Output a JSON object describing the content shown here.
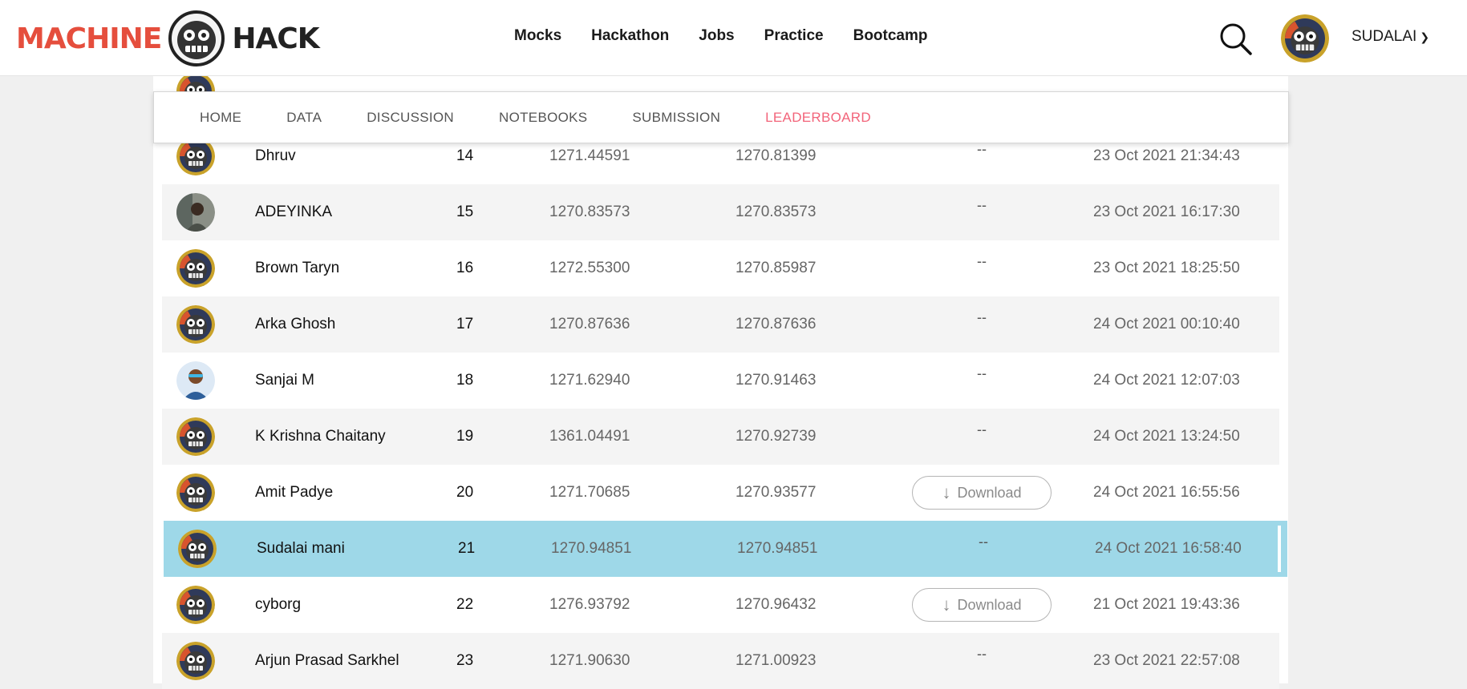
{
  "brand": {
    "word1": "MACHINE",
    "word2": "HACK"
  },
  "nav": {
    "items": [
      "Mocks",
      "Hackathon",
      "Jobs",
      "Practice",
      "Bootcamp"
    ]
  },
  "user": {
    "name": "SUDALAI"
  },
  "tabs": {
    "items": [
      "HOME",
      "DATA",
      "DISCUSSION",
      "NOTEBOOKS",
      "SUBMISSION",
      "LEADERBOARD"
    ],
    "active": "LEADERBOARD"
  },
  "leaderboard": {
    "rows": [
      {
        "name": "Dhruv",
        "rank": "14",
        "score_public": "1271.44591",
        "score_private": "1270.81399",
        "submission": "--",
        "date": "23 Oct 2021 21:34:43",
        "avatar_icon": "robot-avatar-icon"
      },
      {
        "name": "ADEYINKA",
        "rank": "15",
        "score_public": "1270.83573",
        "score_private": "1270.83573",
        "submission": "--",
        "date": "23 Oct 2021 16:17:30",
        "avatar_icon": "user-photo-icon"
      },
      {
        "name": "Brown Taryn",
        "rank": "16",
        "score_public": "1272.55300",
        "score_private": "1270.85987",
        "submission": "--",
        "date": "23 Oct 2021 18:25:50",
        "avatar_icon": "robot-avatar-icon"
      },
      {
        "name": "Arka Ghosh",
        "rank": "17",
        "score_public": "1270.87636",
        "score_private": "1270.87636",
        "submission": "--",
        "date": "24 Oct 2021 00:10:40",
        "avatar_icon": "robot-avatar-icon"
      },
      {
        "name": "Sanjai M",
        "rank": "18",
        "score_public": "1271.62940",
        "score_private": "1270.91463",
        "submission": "--",
        "date": "24 Oct 2021 12:07:03",
        "avatar_icon": "user-photo-icon"
      },
      {
        "name": "K Krishna Chaitany",
        "rank": "19",
        "score_public": "1361.04491",
        "score_private": "1270.92739",
        "submission": "--",
        "date": "24 Oct 2021 13:24:50",
        "avatar_icon": "robot-avatar-icon"
      },
      {
        "name": "Amit Padye",
        "rank": "20",
        "score_public": "1271.70685",
        "score_private": "1270.93577",
        "submission": "Download",
        "date": "24 Oct 2021 16:55:56",
        "avatar_icon": "robot-avatar-icon"
      },
      {
        "name": "Sudalai mani",
        "rank": "21",
        "score_public": "1270.94851",
        "score_private": "1270.94851",
        "submission": "--",
        "date": "24 Oct 2021 16:58:40",
        "avatar_icon": "robot-avatar-icon",
        "current_user": true
      },
      {
        "name": "cyborg",
        "rank": "22",
        "score_public": "1276.93792",
        "score_private": "1270.96432",
        "submission": "Download",
        "date": "21 Oct 2021 19:43:36",
        "avatar_icon": "robot-avatar-icon"
      },
      {
        "name": "Arjun Prasad Sarkhel",
        "rank": "23",
        "score_public": "1271.90630",
        "score_private": "1271.00923",
        "submission": "--",
        "date": "23 Oct 2021 22:57:08",
        "avatar_icon": "robot-avatar-icon"
      }
    ]
  },
  "colors": {
    "accent": "#f2647a",
    "brand_red": "#e54e3d",
    "highlight_row": "#9ed8e8"
  }
}
